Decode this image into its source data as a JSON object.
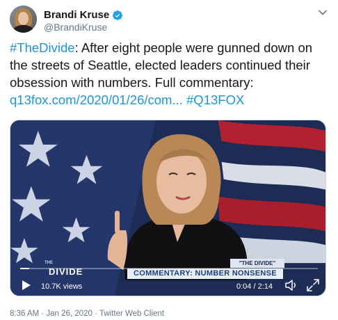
{
  "author": {
    "display_name": "Brandi Kruse",
    "handle": "@BrandiKruse",
    "verified": true
  },
  "tweet": {
    "hashtag": "#TheDivide",
    "body": ": After eight people were gunned down on the streets of Seattle, elected leaders continued their obsession with numbers. Full commentary: ",
    "link": "q13fox.com/2020/01/26/com...",
    "trailing_hashtag": "#Q13FOX"
  },
  "video": {
    "show_logo": "THE",
    "show_name": "DIVIDE",
    "tag": "\"THE DIVIDE\"",
    "chyron": "COMMENTARY: NUMBER NONSENSE",
    "views": "10.7K views",
    "time": "0:04 / 2:14",
    "progress": 0.03
  },
  "meta": {
    "timestamp": "8:36 AM · Jan 26, 2020",
    "separator": " · ",
    "client": "Twitter Web Client"
  },
  "colors": {
    "link": "#1b95e0",
    "verified": "#1da1f2",
    "secondary_text": "#657786"
  },
  "icons": {
    "verified": "verified-badge-icon",
    "caret": "chevron-down-icon",
    "play": "play-icon",
    "volume": "volume-icon",
    "fullscreen": "fullscreen-icon"
  }
}
